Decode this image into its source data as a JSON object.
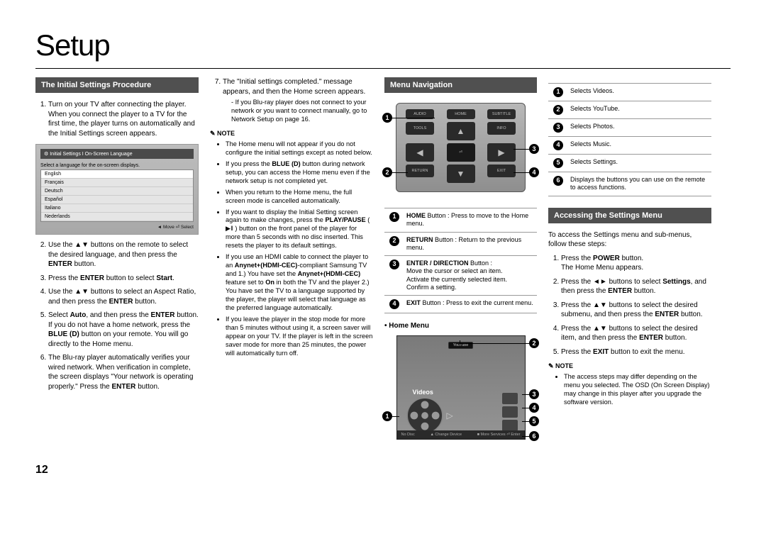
{
  "title": "Setup",
  "page_number": "12",
  "sections": {
    "initial": "The Initial Settings Procedure",
    "menu_nav": "Menu Navigation",
    "accessing": "Accessing the Settings Menu"
  },
  "col1_steps": {
    "1": "Turn on your TV after connecting the player.",
    "1b": "When you connect the player to a TV for the first time, the player turns on automatically and the Initial Settings screen appears.",
    "2a": "Use the ▲▼ buttons on the remote to select the desired language, and then press the ",
    "2b": "ENTER",
    "2c": " button.",
    "3a": "Press the ",
    "3b": "ENTER",
    "3c": " button to select ",
    "3d": "Start",
    "3e": ".",
    "4a": "Use the ▲▼ buttons to select an Aspect Ratio, and then press the ",
    "4b": "ENTER",
    "4c": " button.",
    "5a": "Select ",
    "5b": "Auto",
    "5c": ", and then press the ",
    "5d": "ENTER",
    "5e": " button. If you do not have a home network, press the ",
    "5f": "BLUE (D)",
    "5g": " button on your remote. You will go directly to the Home menu.",
    "6a": "The Blu-ray player automatically verifies your wired network. When verification in complete, the screen displays \"Your network is operating properly.\" Press the ",
    "6b": "ENTER",
    "6c": " button."
  },
  "lang_box": {
    "title": "Initial Settings I On-Screen Language",
    "caption": "Select a language for the on-screen displays.",
    "items": [
      "English",
      "Français",
      "Deutsch",
      "Español",
      "Italiano",
      "Nederlands"
    ],
    "footer": "◄ Move   ⏎ Select"
  },
  "col2": {
    "7": "The \"Initial settings completed.\" message appears, and then the Home screen appears.",
    "7sub": "If you Blu-ray player does not connect to your network or you want to connect manually, go to Network Setup on page 16.",
    "note": "NOTE",
    "bullets": [
      "The Home menu will not appear if you do not configure the initial settings except as noted below.",
      "If you press the <b>BLUE (D)</b> button during network setup, you can access the Home menu even if the network setup is not completed yet.",
      "When you return to the Home menu, the full screen mode is cancelled automatically.",
      "If you want to display the Initial Setting screen again to make changes, press the <b>PLAY/PAUSE</b> ( ▶‖ ) button on the front panel of the player for more than 5 seconds with no disc inserted. This resets the player to its default settings.",
      "If you use an HDMI cable to connect the player to an <b>Anynet+(HDMI-CEC)</b>-compliant Samsung TV and 1.) You have set the <b>Anynet+(HDMI-CEC)</b> feature set to <b>On</b> in both the TV and the player 2.) You have set the TV to a language supported by the player, the player will select that language as the preferred language automatically.",
      "If you leave the player in the stop mode for more than 5 minutes without using it, a screen saver will appear on your TV. If the player is left in the screen saver mode for more than 25 minutes, the power will automatically turn off."
    ]
  },
  "remote": {
    "labels": [
      "AUDIO",
      "HOME",
      "SUBTITLE",
      "TOOLS",
      "INFO",
      "RETURN",
      "EXIT"
    ],
    "table": [
      {
        "n": "1",
        "h": "HOME",
        "t": " Button : Press to move to the Home menu."
      },
      {
        "n": "2",
        "h": "RETURN",
        "t": " Button : Return to the previous menu."
      },
      {
        "n": "3",
        "h": "ENTER / DIRECTION",
        "t": " Button :\nMove the cursor or select an item.\nActivate the currently selected item.\nConfirm a setting."
      },
      {
        "n": "4",
        "h": "EXIT",
        "t": " Button : Press to exit the current menu."
      }
    ]
  },
  "home_menu_label": "Home Menu",
  "home_menu": {
    "youtube": "YouTube",
    "videos": "Videos",
    "footer": [
      "No Disc",
      "▲ Change Device",
      "■ More Services   ⏎ Enter"
    ]
  },
  "col4_table": [
    {
      "n": "1",
      "t": "Selects Videos."
    },
    {
      "n": "2",
      "t": "Selects YouTube."
    },
    {
      "n": "3",
      "t": "Selects Photos."
    },
    {
      "n": "4",
      "t": "Selects Music."
    },
    {
      "n": "5",
      "t": "Selects Settings."
    },
    {
      "n": "6",
      "t": "Displays the buttons you can use on the remote to access functions."
    }
  ],
  "accessing_intro": "To access the Settings menu and sub-menus, follow these steps:",
  "accessing_steps": {
    "1a": "Press the ",
    "1b": "POWER",
    "1c": " button.\nThe Home Menu appears.",
    "2a": "Press the ◄► buttons to select ",
    "2b": "Settings",
    "2c": ", and then press the ",
    "2d": "ENTER",
    "2e": " button.",
    "3a": "Press the ▲▼ buttons to select the desired submenu, and then press the ",
    "3b": "ENTER",
    "3c": " button.",
    "4a": "Press the ▲▼ buttons to select the desired item, and then press the ",
    "4b": "ENTER",
    "4c": " button.",
    "5a": "Press the ",
    "5b": "EXIT",
    "5c": " button to exit the menu."
  },
  "col4_note": "NOTE",
  "col4_note_bullet": "The access steps may differ depending on the menu you selected. The OSD (On Screen Display) may change in this player after you upgrade the software version."
}
